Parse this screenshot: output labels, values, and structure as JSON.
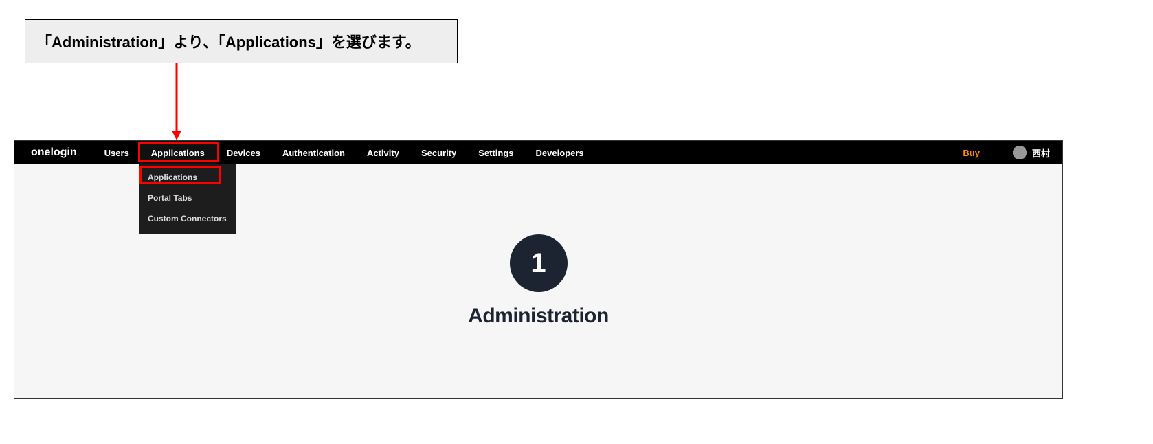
{
  "callout": {
    "text": "「Administration」より、「Applications」を選びます。"
  },
  "logo": "onelogin",
  "nav": {
    "items": [
      {
        "label": "Users"
      },
      {
        "label": "Applications",
        "active": true
      },
      {
        "label": "Devices"
      },
      {
        "label": "Authentication"
      },
      {
        "label": "Activity"
      },
      {
        "label": "Security"
      },
      {
        "label": "Settings"
      },
      {
        "label": "Developers"
      }
    ],
    "buy": "Buy",
    "username": "西村"
  },
  "dropdown": {
    "items": [
      {
        "label": "Applications",
        "highlighted": true
      },
      {
        "label": "Portal Tabs"
      },
      {
        "label": "Custom Connectors"
      }
    ]
  },
  "center": {
    "step_number": "1",
    "title": "Administration"
  }
}
